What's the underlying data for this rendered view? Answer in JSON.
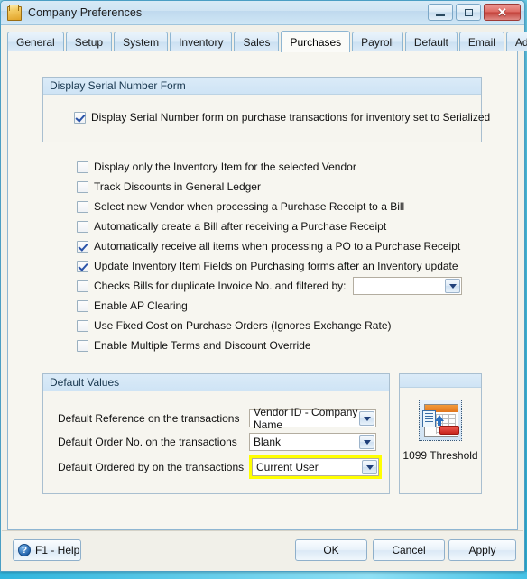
{
  "window": {
    "title": "Company Preferences",
    "icon": "folder-icon",
    "buttons": {
      "minimize": "minimize-icon",
      "maximize": "maximize-icon",
      "close": "✕"
    }
  },
  "tabs": [
    {
      "label": "General",
      "active": false
    },
    {
      "label": "Setup",
      "active": false
    },
    {
      "label": "System",
      "active": false
    },
    {
      "label": "Inventory",
      "active": false
    },
    {
      "label": "Sales",
      "active": false
    },
    {
      "label": "Purchases",
      "active": true
    },
    {
      "label": "Payroll",
      "active": false
    },
    {
      "label": "Default",
      "active": false
    },
    {
      "label": "Email",
      "active": false
    },
    {
      "label": "Add-Ons",
      "active": false
    }
  ],
  "serial_group": {
    "header": "Display Serial Number Form",
    "checkbox": {
      "label": "Display Serial Number form on purchase transactions for inventory set to Serialized",
      "checked": true
    }
  },
  "options": [
    {
      "label": "Display only the Inventory Item for the selected Vendor",
      "checked": false
    },
    {
      "label": "Track Discounts in General Ledger",
      "checked": false
    },
    {
      "label": "Select new Vendor when processing a Purchase Receipt to a Bill",
      "checked": false
    },
    {
      "label": "Automatically create a Bill after receiving a Purchase Receipt",
      "checked": false
    },
    {
      "label": "Automatically receive all items when processing a PO to a Purchase Receipt",
      "checked": true
    },
    {
      "label": "Update Inventory Item Fields on Purchasing forms after an Inventory update",
      "checked": true
    },
    {
      "label": "Checks Bills for duplicate Invoice No. and filtered by:",
      "checked": false,
      "combo": ""
    },
    {
      "label": "Enable AP Clearing",
      "checked": false
    },
    {
      "label": "Use Fixed Cost on Purchase Orders (Ignores Exchange Rate)",
      "checked": false
    },
    {
      "label": "Enable Multiple Terms and Discount Override",
      "checked": false
    }
  ],
  "default_values": {
    "header": "Default Values",
    "fields": [
      {
        "label": "Default Reference on the transactions",
        "value": "Vendor ID - Company Name",
        "highlighted": false
      },
      {
        "label": "Default Order No. on the transactions",
        "value": "Blank",
        "highlighted": false
      },
      {
        "label": "Default Ordered by on the transactions",
        "value": "Current User",
        "highlighted": true
      }
    ]
  },
  "threshold_panel": {
    "label": "1099 Threshold",
    "icon": "report-export-icon"
  },
  "footer": {
    "help": "F1 - Help",
    "help_icon": "?",
    "ok": "OK",
    "cancel": "Cancel",
    "apply": "Apply"
  },
  "colors": {
    "highlight": "#ffff00",
    "accent": "#cfe4f5",
    "close": "#c3423b"
  }
}
